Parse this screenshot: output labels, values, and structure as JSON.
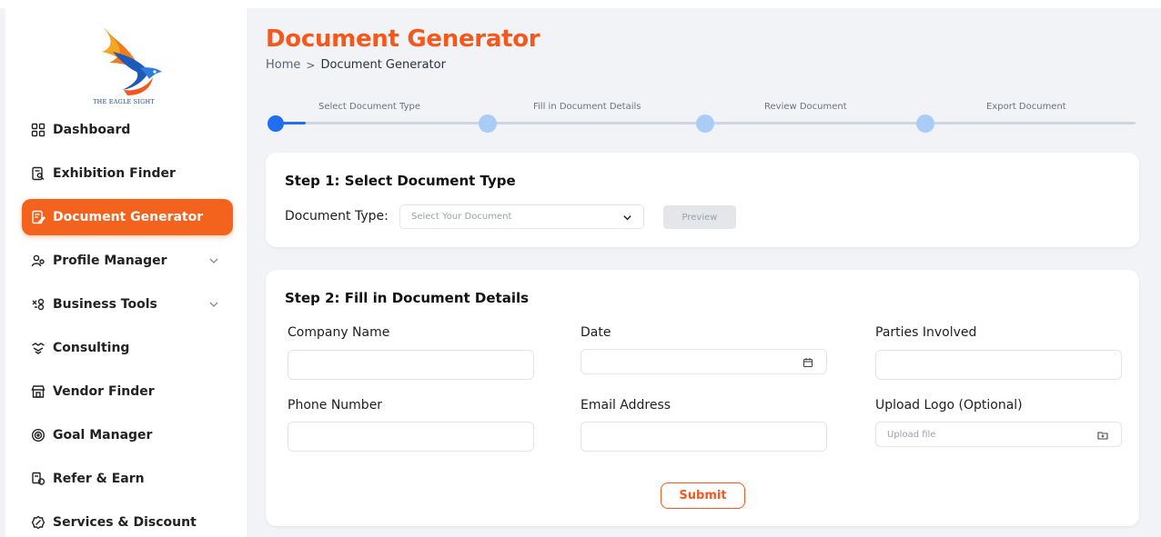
{
  "brand": {
    "logo_text": "THE EAGLE SIGHT",
    "accent": "#f4581c",
    "step_blue": "#1e6ff1",
    "step_inactive": "#a9cdf7"
  },
  "sidebar": {
    "items": [
      {
        "label": "Dashboard",
        "icon": "grid-icon"
      },
      {
        "label": "Exhibition Finder",
        "icon": "search-document-icon"
      },
      {
        "label": "Document Generator",
        "icon": "document-edit-icon",
        "active": true
      },
      {
        "label": "Profile Manager",
        "icon": "users-icon",
        "expandable": true
      },
      {
        "label": "Business Tools",
        "icon": "tools-icon",
        "expandable": true
      },
      {
        "label": "Consulting",
        "icon": "handshake-icon"
      },
      {
        "label": "Vendor Finder",
        "icon": "store-icon"
      },
      {
        "label": "Goal Manager",
        "icon": "target-icon"
      },
      {
        "label": "Refer & Earn",
        "icon": "refer-icon"
      },
      {
        "label": "Services & Discount",
        "icon": "discount-icon"
      }
    ]
  },
  "header": {
    "title": "Document Generator",
    "breadcrumb": {
      "home": "Home",
      "separator": ">",
      "current": "Document Generator"
    }
  },
  "stepper": {
    "current_step": 1,
    "steps": [
      {
        "label": "Select Document Type"
      },
      {
        "label": "Fill in Document Details"
      },
      {
        "label": "Review Document"
      },
      {
        "label": "Export Document"
      }
    ]
  },
  "step1": {
    "title": "Step 1:  Select Document Type",
    "document_type_label": "Document Type:",
    "select_placeholder": "Select Your Document",
    "preview_label": "Preview"
  },
  "step2": {
    "title": "Step 2:  Fill in Document Details",
    "fields": {
      "company_name": {
        "label": "Company Name",
        "value": ""
      },
      "date": {
        "label": "Date",
        "value": ""
      },
      "parties": {
        "label": "Parties Involved",
        "value": ""
      },
      "phone": {
        "label": "Phone Number",
        "value": ""
      },
      "email": {
        "label": "Email Address",
        "value": ""
      },
      "logo": {
        "label": "Upload Logo (Optional)",
        "placeholder": "Upload file"
      }
    },
    "submit_label": "Submit"
  }
}
